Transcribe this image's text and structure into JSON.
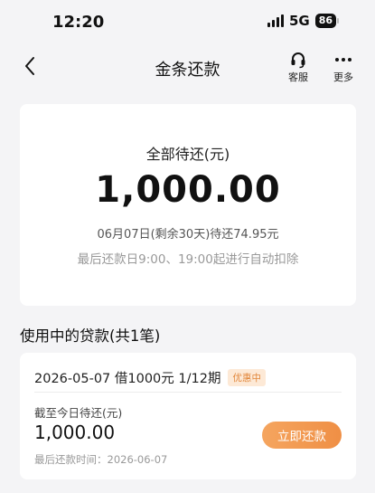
{
  "status_bar": {
    "time": "12:20",
    "network": "5G",
    "battery": "86"
  },
  "nav": {
    "back_icon": "chevron-left-icon",
    "title": "金条还款",
    "service_label": "客服",
    "service_icon": "headset-icon",
    "more_label": "更多",
    "more_icon": "more-dots-icon"
  },
  "summary": {
    "label": "全部待还(元)",
    "amount": "1,000.00",
    "due_text": "06月07日(剩余30天)待还74.95元",
    "note": "最后还款日9:00、19:00起进行自动扣除"
  },
  "loans_section": {
    "title": "使用中的贷款(共1笔)"
  },
  "loan": {
    "title": "2026-05-07 借1000元 1/12期",
    "badge": "优惠中",
    "due_label": "截至今日待还(元)",
    "due_amount": "1,000.00",
    "last_date": "最后还款时间：2026-06-07",
    "repay_label": "立即还款"
  },
  "colors": {
    "accent": "#ef8f45",
    "badge_bg": "#fde9d6",
    "badge_text": "#e2883d",
    "page_bg": "#f4f4f6"
  }
}
